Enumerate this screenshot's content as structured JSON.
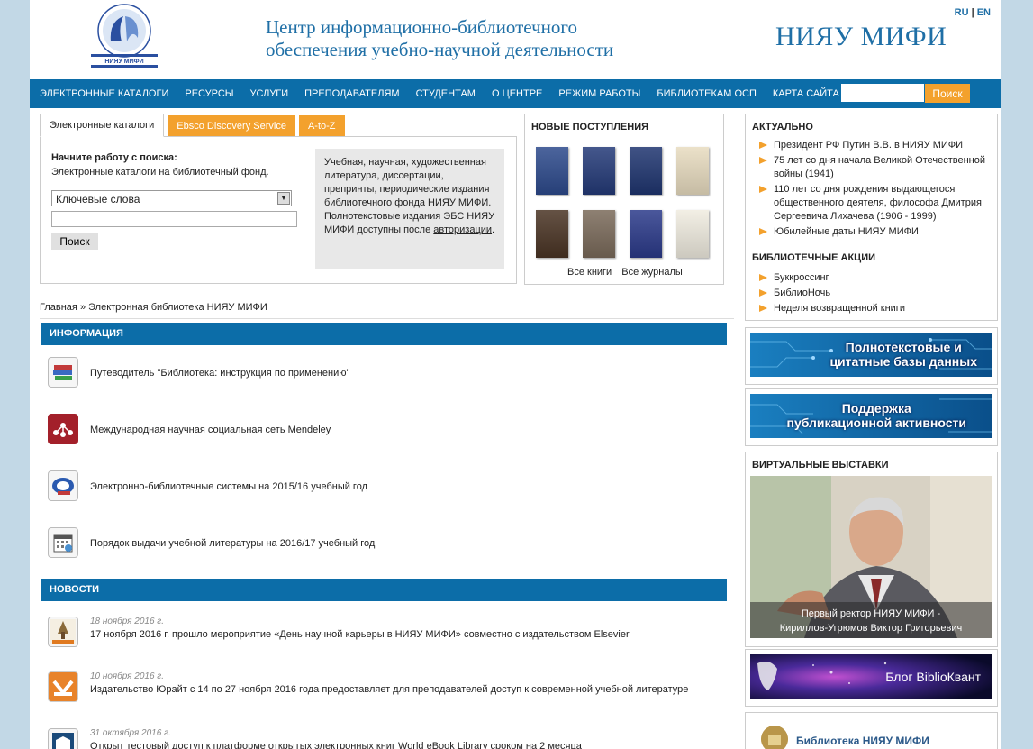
{
  "header": {
    "lang_ru": "RU",
    "lang_sep": "|",
    "lang_en": "EN",
    "title_line1": "Центр информационно-библиотечного",
    "title_line2": "обеспечения учебно-научной деятельности",
    "brand": "НИЯУ МИФИ",
    "logo_caption": "НИЯУ МИФИ"
  },
  "nav": {
    "items": [
      "ЭЛЕКТРОННЫЕ КАТАЛОГИ",
      "РЕСУРСЫ",
      "УСЛУГИ",
      "ПРЕПОДАВАТЕЛЯМ",
      "СТУДЕНТАМ",
      "О ЦЕНТРЕ",
      "РЕЖИМ РАБОТЫ",
      "БИБЛИОТЕКАМ ОСП",
      "КАРТА САЙТА"
    ],
    "search_value": "",
    "search_button": "Поиск"
  },
  "catalog": {
    "tabs": [
      "Электронные каталоги",
      "Ebsco Discovery Service",
      "A-to-Z"
    ],
    "heading": "Начните работу с поиска:",
    "subheading": "Электронные каталоги на библиотечный фонд.",
    "select_value": "Ключевые слова",
    "query_value": "",
    "find_button": "Поиск",
    "info_text": "Учебная, научная, художественная литература, диссертации, препринты, периодические издания библиотечного фонда НИЯУ МИФИ. Полнотекстовые издания ЭБС НИЯУ МИФИ доступны после ",
    "info_link": "авторизации",
    "info_end": "."
  },
  "arrivals": {
    "title": "НОВЫЕ ПОСТУПЛЕНИЯ",
    "all_books": "Все книги",
    "all_journals": "Все журналы",
    "book_covers": [
      "#2d4a8c",
      "#243a78",
      "#1f3570",
      "#e8dcc0",
      "#4a3424",
      "#7a6a5a",
      "#2b3a8a",
      "#f0ece0"
    ]
  },
  "breadcrumb": {
    "home": "Главная",
    "sep": "»",
    "current": "Электронная библиотека НИЯУ МИФИ"
  },
  "info": {
    "title": "ИНФОРМАЦИЯ",
    "items": [
      "Путеводитель \"Библиотека: инструкция по применению\"",
      "Международная научная социальная сеть Mendeley",
      "Электронно-библиотечные системы на 2015/16 учебный год",
      "Порядок выдачи учебной литературы на 2016/17 учебный год"
    ]
  },
  "news": {
    "title": "НОВОСТИ",
    "items": [
      {
        "date": "18 ноября 2016 г.",
        "text": "17 ноября 2016 г. прошло мероприятие «День научной карьеры в НИЯУ МИФИ» совместно с издательством Elsevier"
      },
      {
        "date": "10 ноября 2016 г.",
        "text": "Издательство Юрайт с 14 по 27 ноября 2016 года предоставляет для преподавателей доступ к современной учебной литературе"
      },
      {
        "date": "31 октября 2016 г.",
        "text": "Открыт тестовый доступ к платформе открытых электронных книг World eBook Library сроком на 2 месяца"
      }
    ]
  },
  "actual": {
    "title": "АКТУАЛЬНО",
    "items": [
      "Президент РФ Путин В.В. в НИЯУ МИФИ",
      "75 лет со дня начала Великой Отечественной войны (1941)",
      "110 лет со дня рождения выдающегося общественного деятеля, философа Дмитрия Сергеевича Лихачева (1906 - 1999)",
      "Юбилейные даты НИЯУ МИФИ"
    ],
    "actions_title": "БИБЛИОТЕЧНЫЕ АКЦИИ",
    "actions": [
      "Буккроссинг",
      "БиблиоНочь",
      "Неделя возвращенной книги"
    ]
  },
  "banners": {
    "databases": "Полнотекстовые и цитатные базы данных",
    "databases_l1": "Полнотекстовые и",
    "databases_l2": "цитатные базы данных",
    "support_l1": "Поддержка",
    "support_l2": "публикационной активности",
    "blog": "Блог BiblioКвант"
  },
  "virtual": {
    "title": "ВИРТУАЛЬНЫЕ ВЫСТАВКИ",
    "caption_l1": "Первый ректор НИЯУ МИФИ -",
    "caption_l2": "Кириллов-Угрюмов Виктор Григорьевич"
  },
  "vk": {
    "name": "Библиотека НИЯУ МИФИ"
  },
  "colors": {
    "nav": "#0c6da8",
    "accent": "#f3a12d",
    "title_blue": "#1f6fa6",
    "background": "#c2d8e6"
  }
}
